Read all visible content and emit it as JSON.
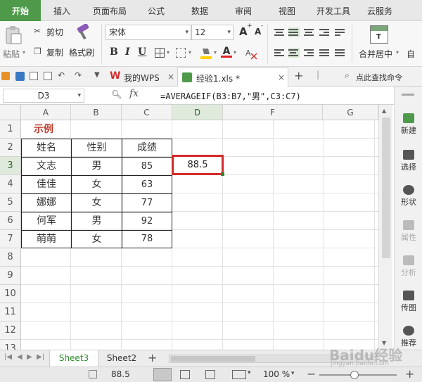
{
  "menu": {
    "tabs": [
      "开始",
      "插入",
      "页面布局",
      "公式",
      "数据",
      "审阅",
      "视图",
      "开发工具",
      "云服务"
    ]
  },
  "ribbon": {
    "paste": "粘贴",
    "cut": "剪切",
    "copy": "复制",
    "format_painter": "格式刷",
    "font_name": "宋体",
    "font_size": "12",
    "grow_font": "A",
    "shrink_font": "A",
    "bold": "B",
    "italic": "I",
    "underline": "U",
    "merge_center": "合并居中",
    "auto_wrap": "自",
    "colors": {
      "fill": "#ffd200",
      "font": "#e02020"
    }
  },
  "doc_tabs": {
    "my_wps": "我的WPS",
    "file": "经验1.xls *",
    "search": "点此查找命令"
  },
  "formula_bar": {
    "name_box": "D3",
    "fx": "fx",
    "formula": "=AVERAGEIF(B3:B7,\"男\",C3:C7)"
  },
  "grid": {
    "columns": [
      "A",
      "B",
      "C",
      "D",
      "F",
      "G"
    ],
    "rows": [
      "1",
      "2",
      "3",
      "4",
      "5",
      "6",
      "7",
      "8",
      "9",
      "10",
      "11",
      "12",
      "13"
    ],
    "title": "示例",
    "headers": [
      "姓名",
      "性别",
      "成绩"
    ],
    "records": [
      [
        "文志",
        "男",
        "85"
      ],
      [
        "佳佳",
        "女",
        "63"
      ],
      [
        "娜娜",
        "女",
        "77"
      ],
      [
        "何军",
        "男",
        "92"
      ],
      [
        "萌萌",
        "女",
        "78"
      ]
    ],
    "result": "88.5"
  },
  "right_panel": {
    "items": [
      "新建",
      "选择",
      "形状",
      "属性",
      "分析",
      "传图",
      "推荐"
    ]
  },
  "sheets": {
    "tabs": [
      "Sheet3",
      "Sheet2"
    ],
    "add": "+"
  },
  "status": {
    "value": "88.5",
    "zoom": "100 %"
  },
  "watermark": {
    "text": "Baidu经验",
    "url": "jingyan.baidu.com"
  },
  "accent": "#4e9a4a",
  "highlight": "#d42a2a"
}
